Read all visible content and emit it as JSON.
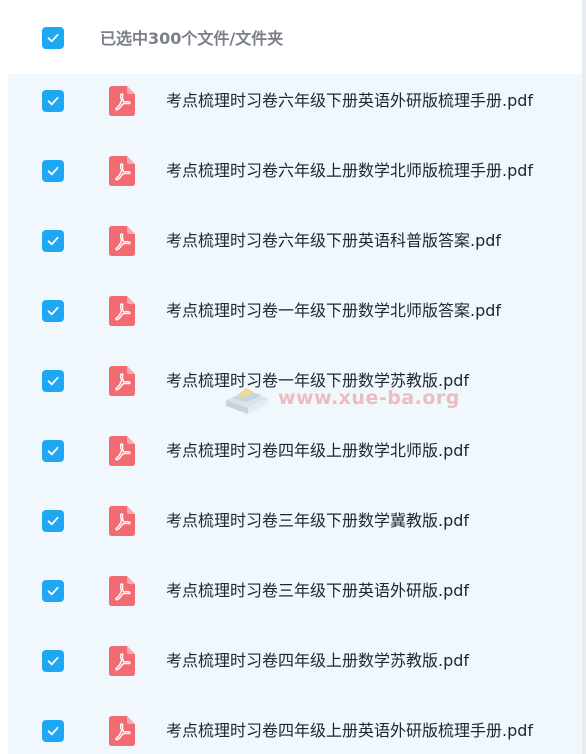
{
  "header": {
    "selected_text": "已选中300个文件/文件夹",
    "checkbox_checked": true
  },
  "files": [
    {
      "name": "考点梳理时习卷六年级下册英语外研版梳理手册.pdf",
      "checked": true
    },
    {
      "name": "考点梳理时习卷六年级上册数学北师版梳理手册.pdf",
      "checked": true
    },
    {
      "name": "考点梳理时习卷六年级下册英语科普版答案.pdf",
      "checked": true
    },
    {
      "name": "考点梳理时习卷一年级下册数学北师版答案.pdf",
      "checked": true
    },
    {
      "name": "考点梳理时习卷一年级下册数学苏教版.pdf",
      "checked": true
    },
    {
      "name": "考点梳理时习卷四年级上册数学北师版.pdf",
      "checked": true
    },
    {
      "name": "考点梳理时习卷三年级下册数学冀教版.pdf",
      "checked": true
    },
    {
      "name": "考点梳理时习卷三年级下册英语外研版.pdf",
      "checked": true
    },
    {
      "name": "考点梳理时习卷四年级上册数学苏教版.pdf",
      "checked": true
    },
    {
      "name": "考点梳理时习卷四年级上册英语外研版梳理手册.pdf",
      "checked": true
    }
  ],
  "icons": {
    "checkbox": "check-icon",
    "file": "pdf-icon"
  },
  "colors": {
    "checkbox": "#1ea7f2",
    "pdf_icon": "#f26b73",
    "list_background": "#f1f8fd"
  },
  "watermark": {
    "text": "www.xue-ba.org"
  }
}
